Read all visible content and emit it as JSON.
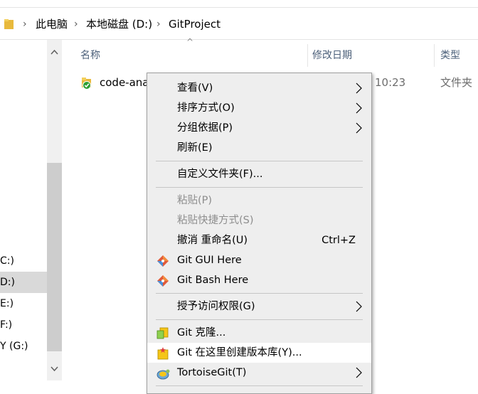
{
  "address": {
    "crumbs": [
      "此电脑",
      "本地磁盘 (D:)",
      "GitProject"
    ]
  },
  "nav": {
    "drives": [
      {
        "label": "C:)",
        "selected": false
      },
      {
        "label": "D:)",
        "selected": true
      },
      {
        "label": "E:)",
        "selected": false
      },
      {
        "label": "F:)",
        "selected": false
      },
      {
        "label": "Y (G:)",
        "selected": false
      }
    ]
  },
  "columns": {
    "name": "名称",
    "date": "修改日期",
    "type": "类型"
  },
  "files": [
    {
      "name": "code-ana",
      "date_tail": "10:23",
      "type": "文件夹"
    }
  ],
  "menu": {
    "view": "查看(V)",
    "sort": "排序方式(O)",
    "group": "分组依据(P)",
    "refresh": "刷新(E)",
    "customize": "自定义文件夹(F)...",
    "paste": "粘贴(P)",
    "paste_shortcut": "粘贴快捷方式(S)",
    "undo": "撤消 重命名(U)",
    "undo_shortcut": "Ctrl+Z",
    "git_gui": "Git GUI Here",
    "git_bash": "Git Bash Here",
    "grant_access": "授予访问权限(G)",
    "git_clone": "Git 克隆...",
    "git_create_repo": "Git 在这里创建版本库(Y)...",
    "tortoise": "TortoiseGit(T)"
  },
  "colors": {
    "menu_bg": "#eeeeee",
    "highlight": "#ffffff",
    "header_text": "#4c607a",
    "disabled": "#8d8d8d"
  }
}
